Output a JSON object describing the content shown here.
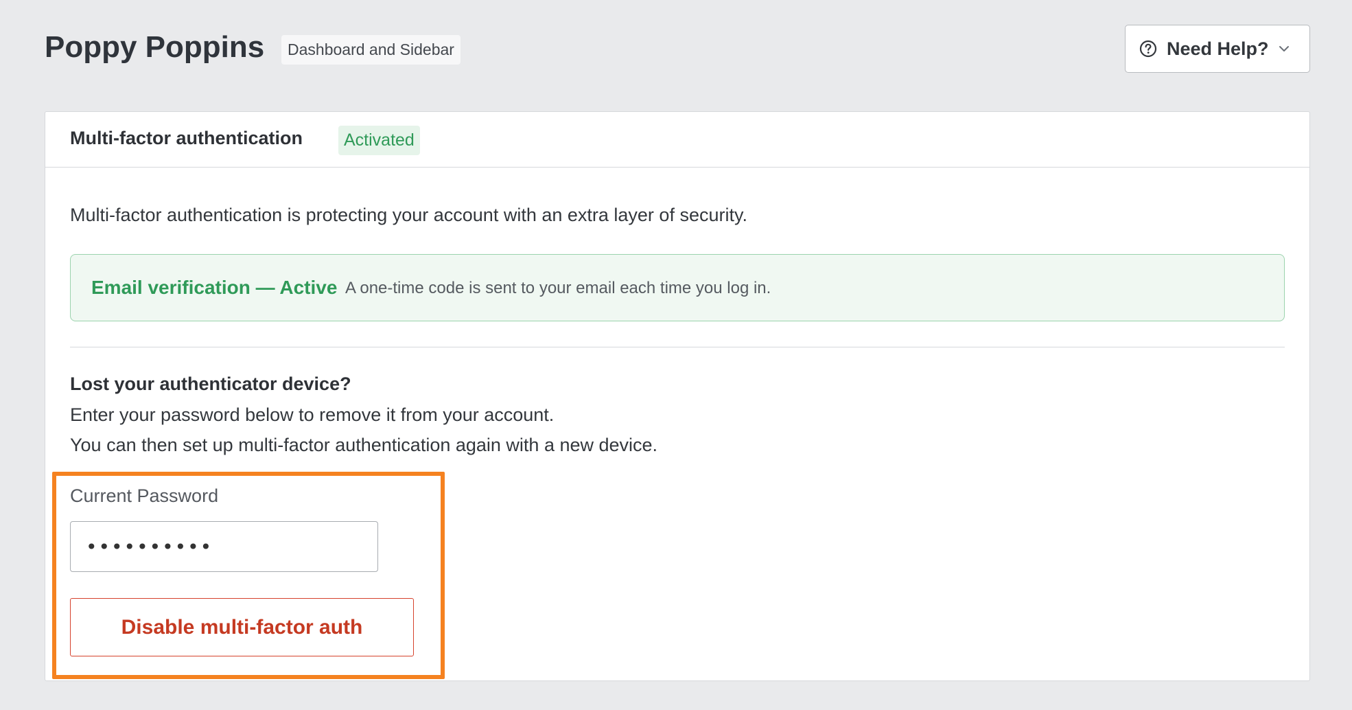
{
  "header": {
    "title": "Poppy Poppins",
    "scope_badge": "Dashboard and Sidebar",
    "help_button": {
      "label": "Need Help?",
      "icon": "question-circle-icon",
      "chevron": "chevron-down-icon"
    }
  },
  "mfa": {
    "title": "Multi-factor authentication",
    "status": "Activated",
    "intro": "Multi-factor authentication is protecting your account with an extra layer of security.",
    "method": {
      "name": "Email verification — Active",
      "description": "A one-time code is sent to your email each time you log in."
    },
    "lost_device": {
      "heading": "Lost your authenticator device?",
      "line1": "Enter your password below to remove it from your account.",
      "line2": "You can then set up multi-factor authentication again with a new device."
    },
    "password": {
      "label": "Current Password",
      "value": "••••••••••"
    },
    "disable_button": "Disable multi-factor auth"
  },
  "colors": {
    "page_bg": "#e9eaec",
    "success": "#2f9a58",
    "danger": "#c53a22",
    "highlight": "#f58220"
  }
}
